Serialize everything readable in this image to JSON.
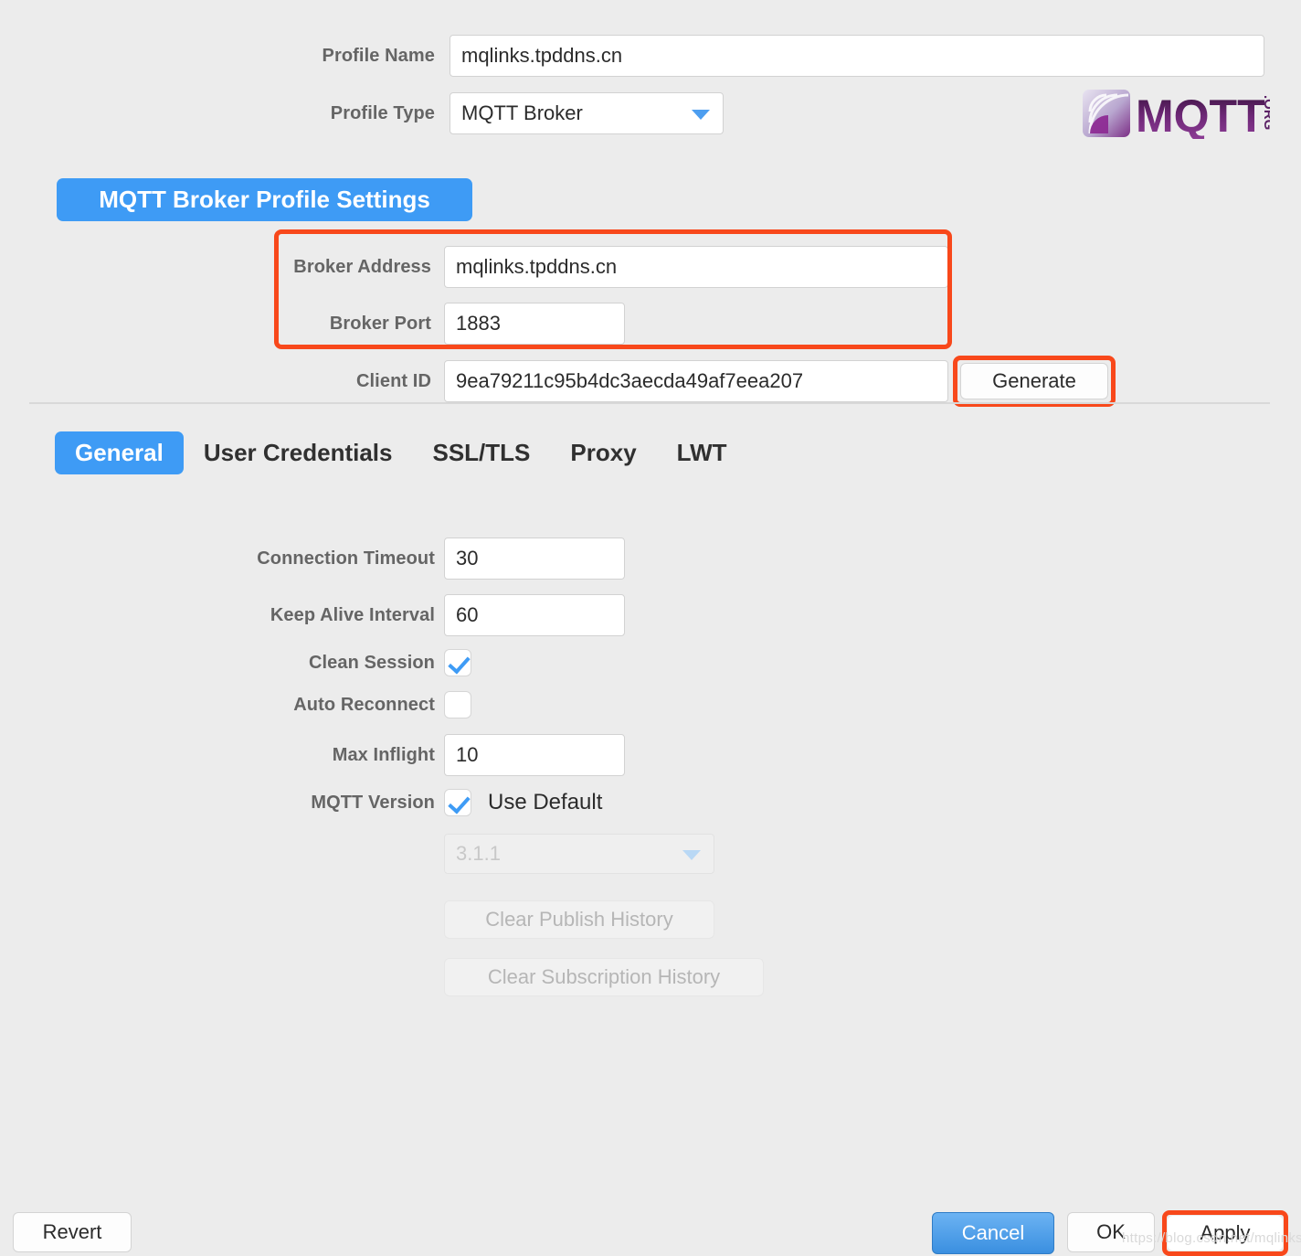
{
  "profile": {
    "name_label": "Profile Name",
    "name_value": "mqlinks.tpddns.cn",
    "name_placeholder": "",
    "type_label": "Profile Type",
    "type_value": "MQTT Broker"
  },
  "logo": {
    "text": "MQTT",
    "suffix": ".ORG",
    "icon": "mqtt-signal-waves-icon"
  },
  "section": {
    "header": "MQTT Broker Profile Settings",
    "broker_address_label": "Broker Address",
    "broker_address_value": "mqlinks.tpddns.cn",
    "broker_port_label": "Broker Port",
    "broker_port_value": "1883",
    "client_id_label": "Client ID",
    "client_id_value": "9ea79211c95b4dc3aecda49af7eea207",
    "generate_label": "Generate"
  },
  "tabs": [
    {
      "label": "General",
      "active": true
    },
    {
      "label": "User Credentials",
      "active": false
    },
    {
      "label": "SSL/TLS",
      "active": false
    },
    {
      "label": "Proxy",
      "active": false
    },
    {
      "label": "LWT",
      "active": false
    }
  ],
  "general": {
    "connection_timeout_label": "Connection Timeout",
    "connection_timeout_value": "30",
    "keep_alive_label": "Keep Alive Interval",
    "keep_alive_value": "60",
    "clean_session_label": "Clean Session",
    "clean_session_checked": true,
    "auto_reconnect_label": "Auto Reconnect",
    "auto_reconnect_checked": false,
    "max_inflight_label": "Max Inflight",
    "max_inflight_value": "10",
    "mqtt_version_label": "MQTT Version",
    "use_default_label": "Use Default",
    "use_default_checked": true,
    "version_value": "3.1.1",
    "clear_publish_label": "Clear Publish History",
    "clear_subscription_label": "Clear Subscription History"
  },
  "footer": {
    "revert_label": "Revert",
    "cancel_label": "Cancel",
    "ok_label": "OK",
    "apply_label": "Apply"
  },
  "watermark": "https://blog.csdn.net/mqlinks",
  "colors": {
    "accent_blue": "#3e9bf5",
    "highlight_red": "#f8481b",
    "background": "#ececec",
    "label_grey": "#656565"
  }
}
